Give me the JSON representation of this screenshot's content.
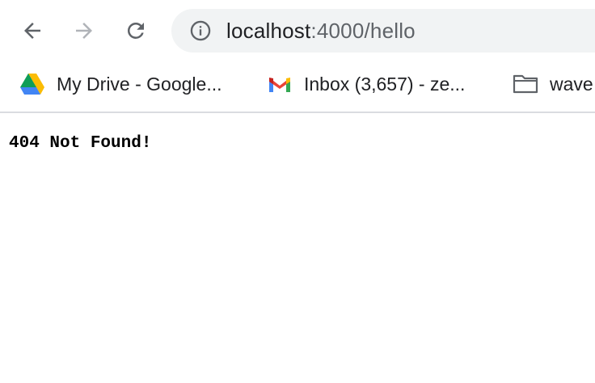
{
  "browser": {
    "address_bar": {
      "host": "localhost",
      "path": ":4000/hello"
    }
  },
  "bookmarks": [
    {
      "label": "My Drive - Google...",
      "icon": "google-drive-icon"
    },
    {
      "label": "Inbox (3,657) - ze...",
      "icon": "gmail-icon"
    },
    {
      "label": "wave",
      "icon": "folder-icon"
    }
  ],
  "page": {
    "body_text": "404 Not Found!"
  },
  "colors": {
    "omnibox_bg": "#f1f3f4",
    "icon_dark": "#5f6368",
    "icon_disabled": "#b0b3b8",
    "divider": "#dadce0"
  }
}
